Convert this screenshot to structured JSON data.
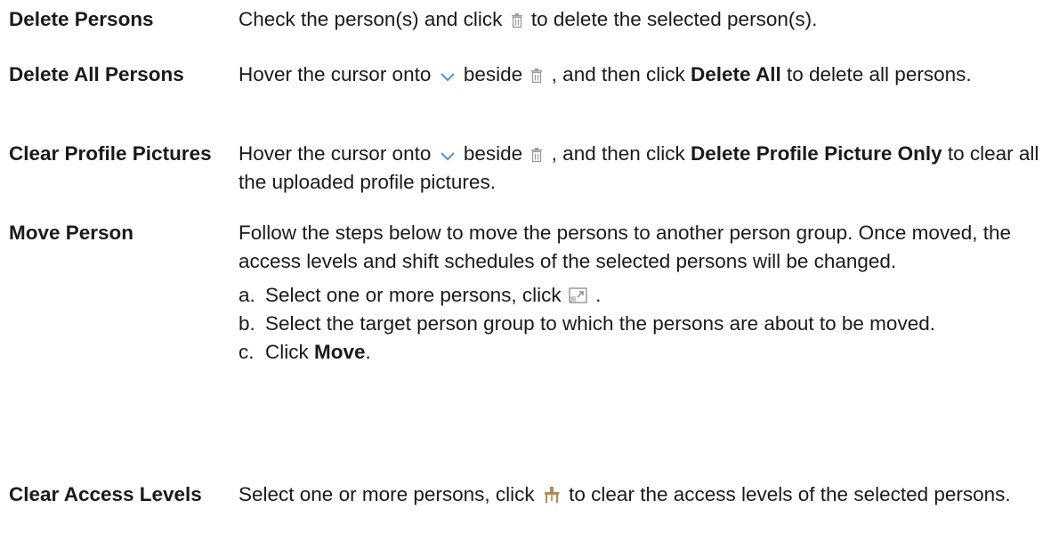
{
  "rows": [
    {
      "term": "Delete Persons",
      "parts": [
        "Check the person(s) and click ",
        "trash-icon",
        " to delete the selected person(s)."
      ]
    },
    {
      "term": "Delete All Persons",
      "parts": [
        "Hover the cursor onto ",
        "chevron-down-icon",
        " beside ",
        "trash-icon",
        " , and then click ",
        "**Delete All",
        " to delete all persons."
      ]
    },
    {
      "term": "Clear Profile Pictures",
      "parts": [
        "Hover the cursor onto ",
        "chevron-down-icon",
        " beside ",
        "trash-icon",
        " , and then click ",
        "**Delete Profile Picture Only",
        " to clear all the uploaded profile pictures."
      ]
    },
    {
      "term": "Move Person",
      "parts": [
        "Follow the steps below to move the persons to another person group. Once moved, the access levels and shift schedules of the selected persons will be changed."
      ],
      "steps": [
        {
          "mark": "a.",
          "parts": [
            "Select one or more persons, click ",
            "move-icon",
            " ."
          ]
        },
        {
          "mark": "b.",
          "parts": [
            "Select the target person group to which the persons are about to be moved."
          ]
        },
        {
          "mark": "c.",
          "parts": [
            "Click ",
            "**Move",
            "."
          ]
        }
      ]
    },
    {
      "term": "Clear Access Levels",
      "parts": [
        "Select one or more persons, click ",
        "clear-access-icon",
        " to clear the access levels of the selected persons."
      ]
    }
  ],
  "icons": {
    "trash-icon": {
      "color": "#9a9a9a"
    },
    "chevron-down-icon": {
      "color": "#4a90d9"
    },
    "move-icon": {
      "color": "#8a8a8a"
    },
    "clear-access-icon": {
      "color": "#b08a5a"
    }
  }
}
